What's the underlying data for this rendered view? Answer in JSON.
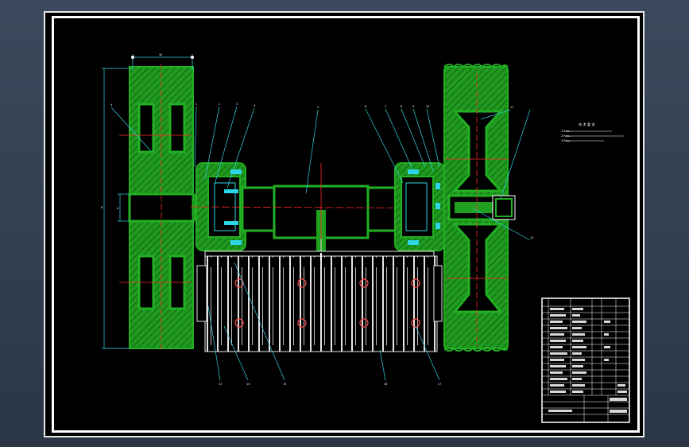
{
  "drawing": {
    "title_block_text": "",
    "dimension_top": "W",
    "dimension_left": "D",
    "dimension_shaft": "d"
  },
  "notes": {
    "heading": "技 术 要 求",
    "lines": [
      "1.Rz≤...",
      "2.Rz≤...",
      "3.Rz≤..."
    ]
  },
  "balloons_top_left": [
    "4",
    "1",
    "2",
    "3",
    "4"
  ],
  "balloons_top_center": [
    "5"
  ],
  "balloons_top_right": [
    "6",
    "7",
    "8",
    "9",
    "10",
    "11",
    "12"
  ],
  "balloons_bottom": [
    "13",
    "14",
    "15",
    "16",
    "17"
  ],
  "colors": {
    "part": "#1fa01f",
    "hatch": "#3ac43a",
    "cyan": "#2bd6e6",
    "red": "#ff2a2a",
    "white": "#ffffff",
    "leader": "#33d6e8"
  }
}
